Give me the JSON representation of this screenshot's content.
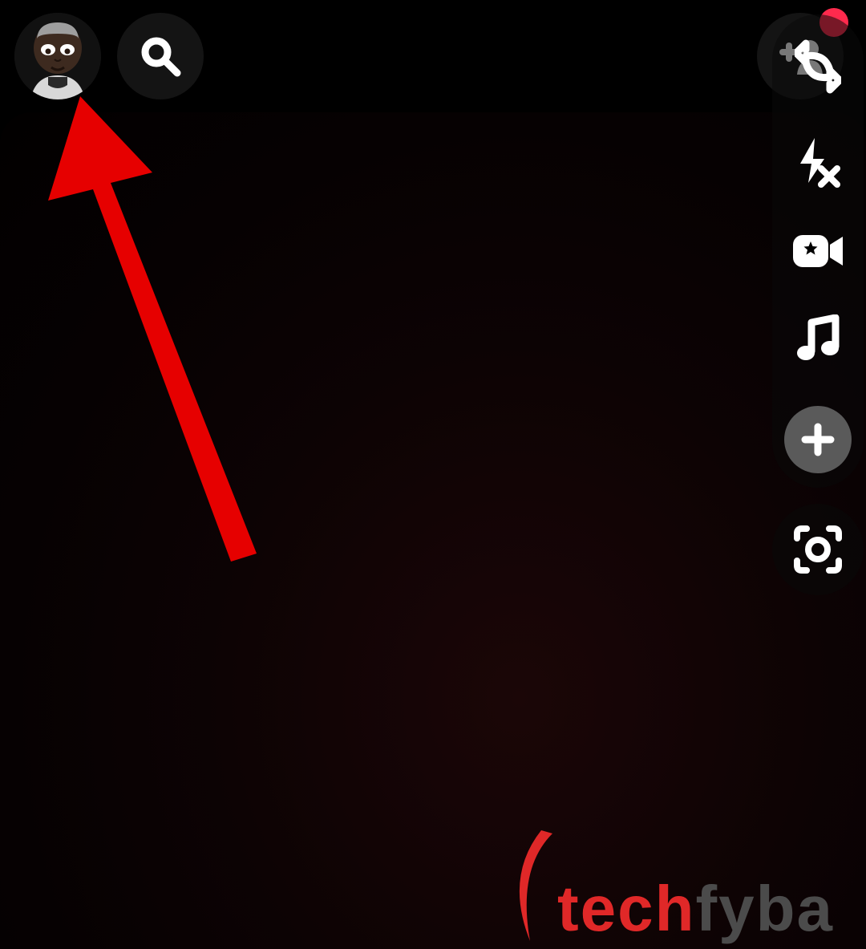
{
  "header": {
    "avatar": "profile-avatar",
    "search": "search",
    "add_friend": "add-friend",
    "flip_camera": "flip-camera",
    "notification_active": true
  },
  "side_tools": {
    "flash": "flash-off",
    "video_effect": "video-effect",
    "music": "music",
    "add_more": "add",
    "scan": "scan"
  },
  "annotation": {
    "arrow_target": "profile-avatar",
    "arrow_color": "#e60000"
  },
  "watermark": {
    "part1": "tech",
    "part2": "fyba",
    "color1": "#e02828",
    "color2": "#4b4b4b"
  }
}
